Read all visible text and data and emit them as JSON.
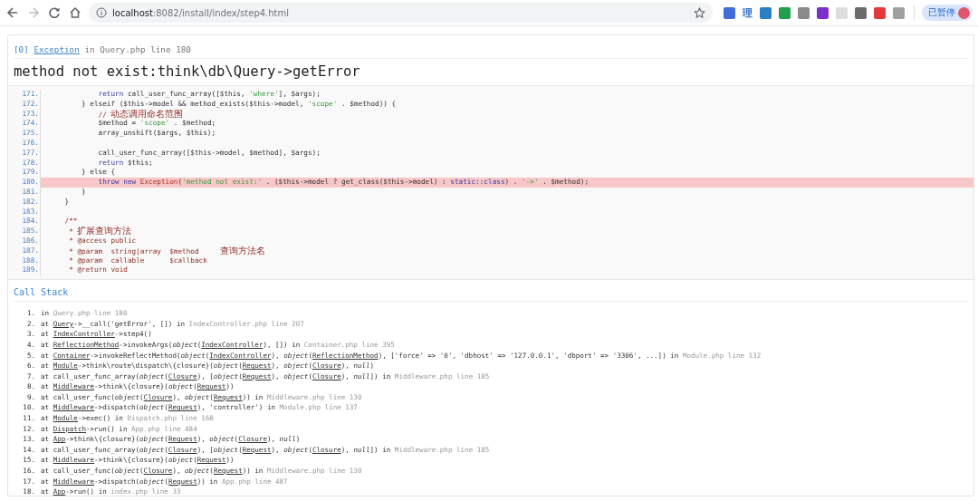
{
  "browser": {
    "url_host": "localhost",
    "url_path": ":8082/install/index/step4.html",
    "extension_label": "理",
    "sync_status": "已暂停"
  },
  "exception": {
    "index": "[0]",
    "type": "Exception",
    "joiner": "in",
    "location": "Query.php line 180",
    "message": "method not exist:think\\db\\Query->getError"
  },
  "source": {
    "lines": [
      {
        "number": "171.",
        "highlighted": false,
        "tokens": [
          {
            "kind": "keyword",
            "text": "            return"
          },
          {
            "kind": "plain",
            "text": " call_user_func_array([$this, "
          },
          {
            "kind": "string",
            "text": "'where'"
          },
          {
            "kind": "plain",
            "text": "], $args);"
          }
        ]
      },
      {
        "number": "172.",
        "highlighted": false,
        "tokens": [
          {
            "kind": "plain",
            "text": "        } elseif ($this->model && method_exists($this->model, "
          },
          {
            "kind": "string",
            "text": "'scope'"
          },
          {
            "kind": "plain",
            "text": " . $method)) {"
          }
        ]
      },
      {
        "number": "173.",
        "highlighted": false,
        "tokens": [
          {
            "kind": "comment",
            "text": "            // 动态调用命名范围"
          }
        ]
      },
      {
        "number": "174.",
        "highlighted": false,
        "tokens": [
          {
            "kind": "plain",
            "text": "            $method = "
          },
          {
            "kind": "string",
            "text": "'scope'"
          },
          {
            "kind": "plain",
            "text": " . $method;"
          }
        ]
      },
      {
        "number": "175.",
        "highlighted": false,
        "tokens": [
          {
            "kind": "plain",
            "text": "            array_unshift($args, $this);"
          }
        ]
      },
      {
        "number": "176.",
        "highlighted": false
      },
      {
        "number": "177.",
        "highlighted": false,
        "tokens": [
          {
            "kind": "plain",
            "text": "            call_user_func_array([$this->model, $method], $args);"
          }
        ]
      },
      {
        "number": "178.",
        "highlighted": false,
        "tokens": [
          {
            "kind": "keyword",
            "text": "            return"
          },
          {
            "kind": "plain",
            "text": " $this;"
          }
        ]
      },
      {
        "number": "179.",
        "highlighted": false,
        "tokens": [
          {
            "kind": "plain",
            "text": "        } else {"
          }
        ]
      },
      {
        "number": "180.",
        "highlighted": true,
        "tokens": [
          {
            "kind": "keyword",
            "text": "            throw new "
          },
          {
            "kind": "class",
            "text": "Exception"
          },
          {
            "kind": "plain",
            "text": "("
          },
          {
            "kind": "string",
            "text": "'method not exist:'"
          },
          {
            "kind": "plain",
            "text": " . ($this->model ? get_class($this->model) : "
          },
          {
            "kind": "keyword",
            "text": "static::class"
          },
          {
            "kind": "plain",
            "text": ") . "
          },
          {
            "kind": "string",
            "text": "'->'"
          },
          {
            "kind": "plain",
            "text": " . $method);"
          }
        ]
      },
      {
        "number": "181.",
        "highlighted": false,
        "tokens": [
          {
            "kind": "plain",
            "text": "        }"
          }
        ]
      },
      {
        "number": "182.",
        "highlighted": false,
        "tokens": [
          {
            "kind": "plain",
            "text": "    }"
          }
        ]
      },
      {
        "number": "183.",
        "highlighted": false
      },
      {
        "number": "184.",
        "highlighted": false,
        "tokens": [
          {
            "kind": "comment",
            "text": "    /**"
          }
        ]
      },
      {
        "number": "185.",
        "highlighted": false,
        "tokens": [
          {
            "kind": "comment",
            "text": "     * 扩展查询方法"
          }
        ]
      },
      {
        "number": "186.",
        "highlighted": false,
        "tokens": [
          {
            "kind": "comment",
            "text": "     * @access public"
          }
        ]
      },
      {
        "number": "187.",
        "highlighted": false,
        "tokens": [
          {
            "kind": "comment",
            "text": "     * @param  string|array  $method     查询方法名"
          }
        ]
      },
      {
        "number": "188.",
        "highlighted": false,
        "tokens": [
          {
            "kind": "comment",
            "text": "     * @param  callable      $callback"
          }
        ]
      },
      {
        "number": "189.",
        "highlighted": false,
        "tokens": [
          {
            "kind": "comment",
            "text": "     * @return void"
          }
        ]
      }
    ]
  },
  "call_stack": {
    "title": "Call Stack",
    "frames": [
      {
        "number": "1.",
        "parts": [
          {
            "kind": "plain",
            "text": "in "
          },
          {
            "kind": "file",
            "text": "Query.php line 180"
          }
        ]
      },
      {
        "number": "2.",
        "parts": [
          {
            "kind": "plain",
            "text": "at "
          },
          {
            "kind": "class",
            "text": "Query"
          },
          {
            "kind": "plain",
            "text": "->__call('getError', []) in "
          },
          {
            "kind": "file",
            "text": "IndexController.php line 207"
          }
        ]
      },
      {
        "number": "3.",
        "parts": [
          {
            "kind": "plain",
            "text": "at "
          },
          {
            "kind": "class",
            "text": "IndexController"
          },
          {
            "kind": "plain",
            "text": "->step4()"
          }
        ]
      },
      {
        "number": "4.",
        "parts": [
          {
            "kind": "plain",
            "text": "at "
          },
          {
            "kind": "class",
            "text": "ReflectionMethod"
          },
          {
            "kind": "plain",
            "text": "->invokeArgs("
          },
          {
            "kind": "italic",
            "text": "object"
          },
          {
            "kind": "plain",
            "text": "("
          },
          {
            "kind": "class",
            "text": "IndexController"
          },
          {
            "kind": "plain",
            "text": "), []) in "
          },
          {
            "kind": "file",
            "text": "Container.php line 395"
          }
        ]
      },
      {
        "number": "5.",
        "parts": [
          {
            "kind": "plain",
            "text": "at "
          },
          {
            "kind": "class",
            "text": "Container"
          },
          {
            "kind": "plain",
            "text": "->invokeReflectMethod("
          },
          {
            "kind": "italic",
            "text": "object"
          },
          {
            "kind": "plain",
            "text": "("
          },
          {
            "kind": "class",
            "text": "IndexController"
          },
          {
            "kind": "plain",
            "text": "), "
          },
          {
            "kind": "italic",
            "text": "object"
          },
          {
            "kind": "plain",
            "text": "("
          },
          {
            "kind": "class",
            "text": "ReflectionMethod"
          },
          {
            "kind": "plain",
            "text": "), ['force' => '0', 'dbhost' => '127.0.0.1', 'dbport' => '3306', ...]) in "
          },
          {
            "kind": "file",
            "text": "Module.php line 132"
          }
        ]
      },
      {
        "number": "6.",
        "parts": [
          {
            "kind": "plain",
            "text": "at "
          },
          {
            "kind": "class",
            "text": "Module"
          },
          {
            "kind": "plain",
            "text": "->think\\route\\dispatch\\{closure}("
          },
          {
            "kind": "italic",
            "text": "object"
          },
          {
            "kind": "plain",
            "text": "("
          },
          {
            "kind": "class",
            "text": "Request"
          },
          {
            "kind": "plain",
            "text": "), "
          },
          {
            "kind": "italic",
            "text": "object"
          },
          {
            "kind": "plain",
            "text": "("
          },
          {
            "kind": "class",
            "text": "Closure"
          },
          {
            "kind": "plain",
            "text": "), "
          },
          {
            "kind": "italic",
            "text": "null"
          },
          {
            "kind": "plain",
            "text": ")"
          }
        ]
      },
      {
        "number": "7.",
        "parts": [
          {
            "kind": "plain",
            "text": "at call_user_func_array("
          },
          {
            "kind": "italic",
            "text": "object"
          },
          {
            "kind": "plain",
            "text": "("
          },
          {
            "kind": "class",
            "text": "Closure"
          },
          {
            "kind": "plain",
            "text": "), ["
          },
          {
            "kind": "italic",
            "text": "object"
          },
          {
            "kind": "plain",
            "text": "("
          },
          {
            "kind": "class",
            "text": "Request"
          },
          {
            "kind": "plain",
            "text": "), "
          },
          {
            "kind": "italic",
            "text": "object"
          },
          {
            "kind": "plain",
            "text": "("
          },
          {
            "kind": "class",
            "text": "Closure"
          },
          {
            "kind": "plain",
            "text": "), "
          },
          {
            "kind": "italic",
            "text": "null"
          },
          {
            "kind": "plain",
            "text": "]) in "
          },
          {
            "kind": "file",
            "text": "Middleware.php line 185"
          }
        ]
      },
      {
        "number": "8.",
        "parts": [
          {
            "kind": "plain",
            "text": "at "
          },
          {
            "kind": "class",
            "text": "Middleware"
          },
          {
            "kind": "plain",
            "text": "->think\\{closure}("
          },
          {
            "kind": "italic",
            "text": "object"
          },
          {
            "kind": "plain",
            "text": "("
          },
          {
            "kind": "class",
            "text": "Request"
          },
          {
            "kind": "plain",
            "text": "))"
          }
        ]
      },
      {
        "number": "9.",
        "parts": [
          {
            "kind": "plain",
            "text": "at call_user_func("
          },
          {
            "kind": "italic",
            "text": "object"
          },
          {
            "kind": "plain",
            "text": "("
          },
          {
            "kind": "class",
            "text": "Closure"
          },
          {
            "kind": "plain",
            "text": "), "
          },
          {
            "kind": "italic",
            "text": "object"
          },
          {
            "kind": "plain",
            "text": "("
          },
          {
            "kind": "class",
            "text": "Request"
          },
          {
            "kind": "plain",
            "text": ")) in "
          },
          {
            "kind": "file",
            "text": "Middleware.php line 130"
          }
        ]
      },
      {
        "number": "10.",
        "parts": [
          {
            "kind": "plain",
            "text": "at "
          },
          {
            "kind": "class",
            "text": "Middleware"
          },
          {
            "kind": "plain",
            "text": "->dispatch("
          },
          {
            "kind": "italic",
            "text": "object"
          },
          {
            "kind": "plain",
            "text": "("
          },
          {
            "kind": "class",
            "text": "Request"
          },
          {
            "kind": "plain",
            "text": "), 'controller') in "
          },
          {
            "kind": "file",
            "text": "Module.php line 137"
          }
        ]
      },
      {
        "number": "11.",
        "parts": [
          {
            "kind": "plain",
            "text": "at "
          },
          {
            "kind": "class",
            "text": "Module"
          },
          {
            "kind": "plain",
            "text": "->exec() in "
          },
          {
            "kind": "file",
            "text": "Dispatch.php line 168"
          }
        ]
      },
      {
        "number": "12.",
        "parts": [
          {
            "kind": "plain",
            "text": "at "
          },
          {
            "kind": "class",
            "text": "Dispatch"
          },
          {
            "kind": "plain",
            "text": "->run() in "
          },
          {
            "kind": "file",
            "text": "App.php line 484"
          }
        ]
      },
      {
        "number": "13.",
        "parts": [
          {
            "kind": "plain",
            "text": "at "
          },
          {
            "kind": "class",
            "text": "App"
          },
          {
            "kind": "plain",
            "text": "->think\\{closure}("
          },
          {
            "kind": "italic",
            "text": "object"
          },
          {
            "kind": "plain",
            "text": "("
          },
          {
            "kind": "class",
            "text": "Request"
          },
          {
            "kind": "plain",
            "text": "), "
          },
          {
            "kind": "italic",
            "text": "object"
          },
          {
            "kind": "plain",
            "text": "("
          },
          {
            "kind": "class",
            "text": "Closure"
          },
          {
            "kind": "plain",
            "text": "), "
          },
          {
            "kind": "italic",
            "text": "null"
          },
          {
            "kind": "plain",
            "text": ")"
          }
        ]
      },
      {
        "number": "14.",
        "parts": [
          {
            "kind": "plain",
            "text": "at call_user_func_array("
          },
          {
            "kind": "italic",
            "text": "object"
          },
          {
            "kind": "plain",
            "text": "("
          },
          {
            "kind": "class",
            "text": "Closure"
          },
          {
            "kind": "plain",
            "text": "), ["
          },
          {
            "kind": "italic",
            "text": "object"
          },
          {
            "kind": "plain",
            "text": "("
          },
          {
            "kind": "class",
            "text": "Request"
          },
          {
            "kind": "plain",
            "text": "), "
          },
          {
            "kind": "italic",
            "text": "object"
          },
          {
            "kind": "plain",
            "text": "("
          },
          {
            "kind": "class",
            "text": "Closure"
          },
          {
            "kind": "plain",
            "text": "), "
          },
          {
            "kind": "italic",
            "text": "null"
          },
          {
            "kind": "plain",
            "text": "]) in "
          },
          {
            "kind": "file",
            "text": "Middleware.php line 185"
          }
        ]
      },
      {
        "number": "15.",
        "parts": [
          {
            "kind": "plain",
            "text": "at "
          },
          {
            "kind": "class",
            "text": "Middleware"
          },
          {
            "kind": "plain",
            "text": "->think\\{closure}("
          },
          {
            "kind": "italic",
            "text": "object"
          },
          {
            "kind": "plain",
            "text": "("
          },
          {
            "kind": "class",
            "text": "Request"
          },
          {
            "kind": "plain",
            "text": "))"
          }
        ]
      },
      {
        "number": "16.",
        "parts": [
          {
            "kind": "plain",
            "text": "at call_user_func("
          },
          {
            "kind": "italic",
            "text": "object"
          },
          {
            "kind": "plain",
            "text": "("
          },
          {
            "kind": "class",
            "text": "Closure"
          },
          {
            "kind": "plain",
            "text": "), "
          },
          {
            "kind": "italic",
            "text": "object"
          },
          {
            "kind": "plain",
            "text": "("
          },
          {
            "kind": "class",
            "text": "Request"
          },
          {
            "kind": "plain",
            "text": ")) in "
          },
          {
            "kind": "file",
            "text": "Middleware.php line 130"
          }
        ]
      },
      {
        "number": "17.",
        "parts": [
          {
            "kind": "plain",
            "text": "at "
          },
          {
            "kind": "class",
            "text": "Middleware"
          },
          {
            "kind": "plain",
            "text": "->dispatch("
          },
          {
            "kind": "italic",
            "text": "object"
          },
          {
            "kind": "plain",
            "text": "("
          },
          {
            "kind": "class",
            "text": "Request"
          },
          {
            "kind": "plain",
            "text": ")) in "
          },
          {
            "kind": "file",
            "text": "App.php line 487"
          }
        ]
      },
      {
        "number": "18.",
        "parts": [
          {
            "kind": "plain",
            "text": "at "
          },
          {
            "kind": "class",
            "text": "App"
          },
          {
            "kind": "plain",
            "text": "->run() in "
          },
          {
            "kind": "file",
            "text": "index.php line 33"
          }
        ]
      }
    ]
  }
}
